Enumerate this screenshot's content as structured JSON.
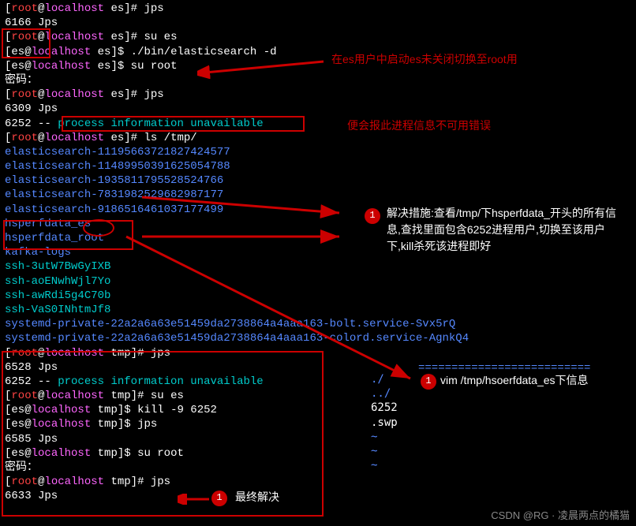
{
  "lines": [
    {
      "type": "prompt",
      "user": "root",
      "host": "localhost",
      "dir": "es",
      "sym": "#",
      "cmd": "jps"
    },
    {
      "type": "plain",
      "text": "6166 Jps"
    },
    {
      "type": "prompt",
      "user": "root",
      "host": "localhost",
      "dir": "es",
      "sym": "#",
      "cmd": "su es"
    },
    {
      "type": "prompt",
      "user": "es",
      "host": "localhost",
      "dir": "es",
      "sym": "$",
      "cmd": "./bin/elasticsearch -d"
    },
    {
      "type": "prompt",
      "user": "es",
      "host": "localhost",
      "dir": "es",
      "sym": "$",
      "cmd": "su root"
    },
    {
      "type": "plain",
      "text": "密码："
    },
    {
      "type": "prompt",
      "user": "root",
      "host": "localhost",
      "dir": "es",
      "sym": "#",
      "cmd": "jps"
    },
    {
      "type": "plain",
      "text": "6309 Jps"
    },
    {
      "type": "procinfo",
      "pid": "6252",
      "dashes": "--",
      "p": "process",
      "i": "information",
      "u": "unavailable"
    },
    {
      "type": "prompt",
      "user": "root",
      "host": "localhost",
      "dir": "es",
      "sym": "#",
      "cmd": "ls /tmp/"
    },
    {
      "type": "blue",
      "text": "elasticsearch-11195663721827424577"
    },
    {
      "type": "blue",
      "text": "elasticsearch-11489950391625054788"
    },
    {
      "type": "blue",
      "text": "elasticsearch-1935811795528524766"
    },
    {
      "type": "blue",
      "text": "elasticsearch-7831982529682987177"
    },
    {
      "type": "blue",
      "text": "elasticsearch-9186516461037177499"
    },
    {
      "type": "blue",
      "text": "hsperfdata_es"
    },
    {
      "type": "blue",
      "text": "hsperfdata_root"
    },
    {
      "type": "blue",
      "text": "kafka-logs"
    },
    {
      "type": "cyan",
      "text": "ssh-3utW7BwGyIXB"
    },
    {
      "type": "cyan",
      "text": "ssh-aoENwhWjl7Yo"
    },
    {
      "type": "cyan",
      "text": "ssh-awRdi5g4C70b"
    },
    {
      "type": "cyan",
      "text": "ssh-VaS0INhtmJf8"
    },
    {
      "type": "blue",
      "text": "systemd-private-22a2a6a63e51459da2738864a4aaa163-bolt.service-Svx5rQ"
    },
    {
      "type": "blue",
      "text": "systemd-private-22a2a6a63e51459da2738864a4aaa163-colord.service-AgnkQ4"
    },
    {
      "type": "prompt",
      "user": "root",
      "host": "localhost",
      "dir": "tmp",
      "sym": "#",
      "cmd": "jps"
    },
    {
      "type": "plain",
      "text": "6528 Jps"
    },
    {
      "type": "procinfo",
      "pid": "6252",
      "dashes": "--",
      "p": "process",
      "i": "information",
      "u": "unavailable"
    },
    {
      "type": "prompt",
      "user": "root",
      "host": "localhost",
      "dir": "tmp",
      "sym": "#",
      "cmd": "su es"
    },
    {
      "type": "prompt",
      "user": "es",
      "host": "localhost",
      "dir": "tmp",
      "sym": "$",
      "cmd": "kill -9 6252"
    },
    {
      "type": "prompt",
      "user": "es",
      "host": "localhost",
      "dir": "tmp",
      "sym": "$",
      "cmd": "jps"
    },
    {
      "type": "plain",
      "text": "6585 Jps"
    },
    {
      "type": "prompt",
      "user": "es",
      "host": "localhost",
      "dir": "tmp",
      "sym": "$",
      "cmd": "su root"
    },
    {
      "type": "plain",
      "text": "密码："
    },
    {
      "type": "prompt",
      "user": "root",
      "host": "localhost",
      "dir": "tmp",
      "sym": "#",
      "cmd": "jps"
    },
    {
      "type": "plain",
      "text": "6633 Jps"
    }
  ],
  "annotations": {
    "a1": "在es用户中启动es未关闭切换至root用",
    "a2": "便会报此进程信息不可用错误",
    "a3": "解决措施:查看/tmp/下hsperfdata_开头的所有信息,查找里面包含6252进程用户,切换至该用户下,kill杀死该进程即好",
    "a4": "vim  /tmp/hsoerfdata_es下信息",
    "a5": "最终解决"
  },
  "vim": {
    "dot_slash": "./",
    "dot_dot_slash": "../",
    "pid": "6252",
    "swp": ".swp"
  },
  "watermark": "CSDN @RG · 凌晨两点的橘猫",
  "badge": "1"
}
